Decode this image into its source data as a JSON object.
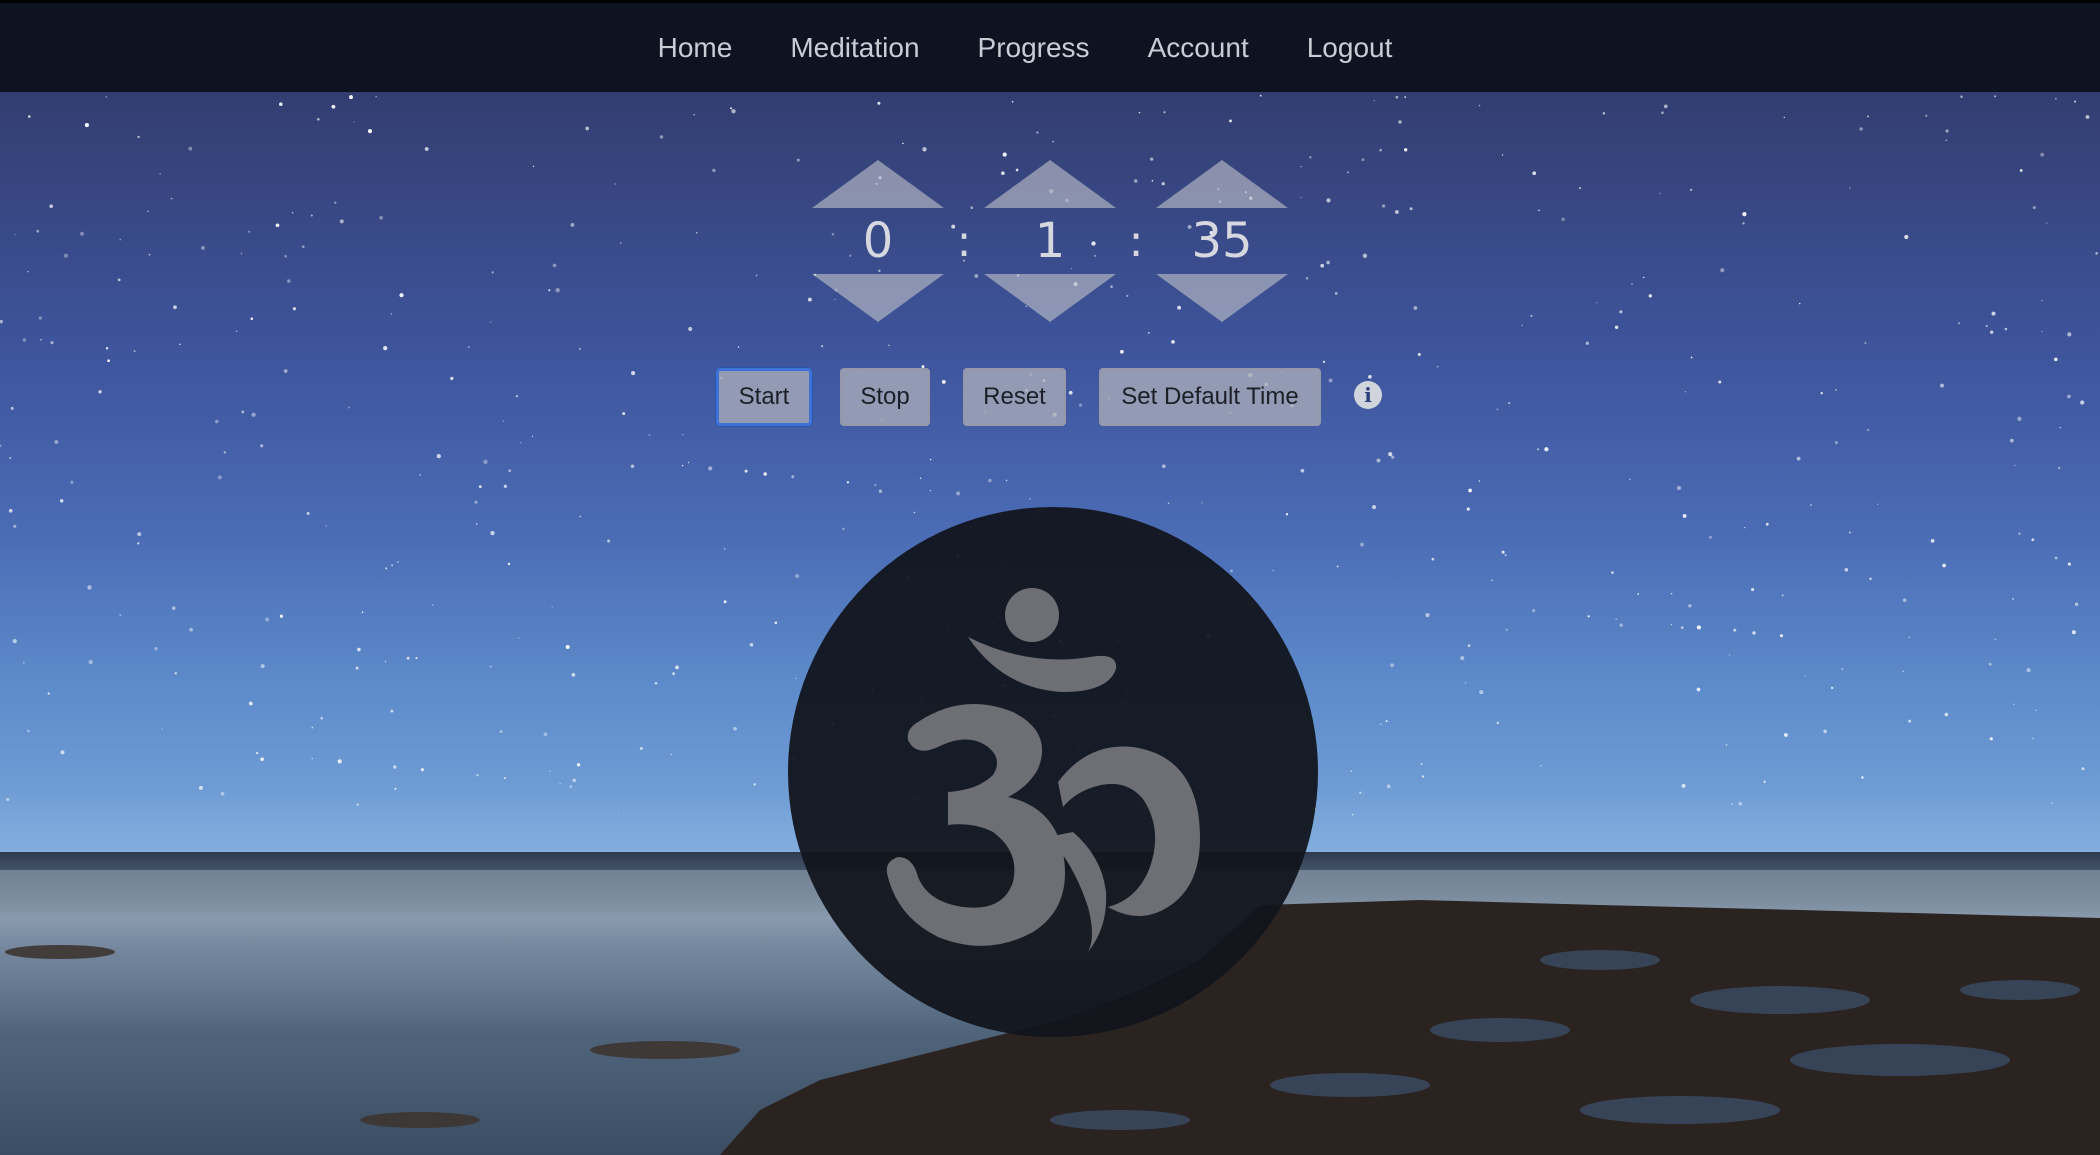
{
  "nav": {
    "items": [
      "Home",
      "Meditation",
      "Progress",
      "Account",
      "Logout"
    ]
  },
  "timer": {
    "hours": "0",
    "minutes": "1",
    "seconds": "35",
    "separator": ":"
  },
  "controls": {
    "start_label": "Start",
    "stop_label": "Stop",
    "reset_label": "Reset",
    "default_label": "Set Default Time",
    "info_glyph": "i"
  },
  "colors": {
    "navbar": "#0e1322",
    "nav_text": "#c9ccd4",
    "start_focus": "#3f72d6"
  },
  "icons": {
    "om_symbol": "om-icon",
    "info": "info-icon"
  }
}
